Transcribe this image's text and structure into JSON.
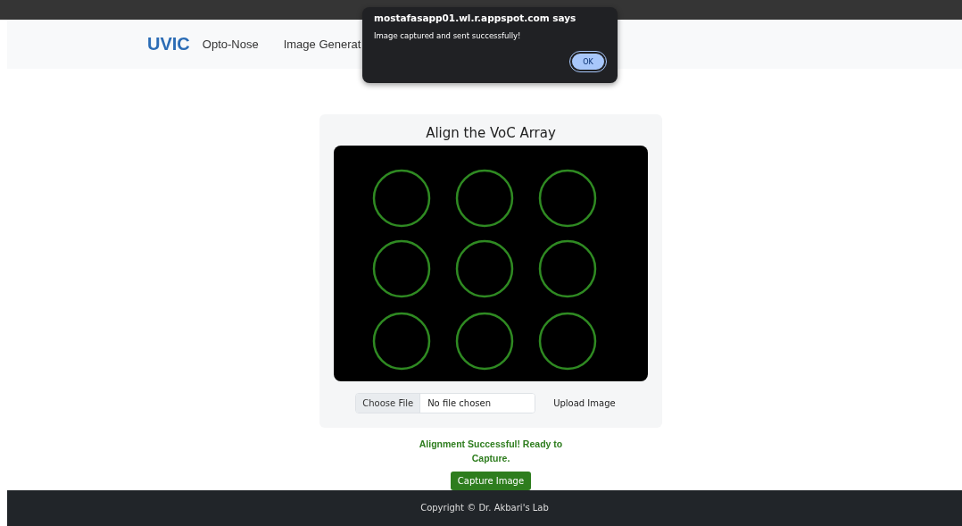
{
  "navbar": {
    "brand": "UVIC",
    "links": [
      {
        "label": "Opto-Nose"
      },
      {
        "label": "Image Generat"
      }
    ]
  },
  "card": {
    "title": "Align the VoC Array",
    "file_input": {
      "button": "Choose File",
      "value": "No file chosen"
    },
    "upload_button": "Upload Image"
  },
  "status_message": "Alignment Successful! Ready to Capture.",
  "capture_button": "Capture Image",
  "footer": {
    "text": "Copyright © Dr. Akbari's Lab"
  },
  "dialog": {
    "title": "mostafasapp01.wl.r.appspot.com says",
    "message": "Image captured and sent successfully!",
    "button": "OK"
  }
}
